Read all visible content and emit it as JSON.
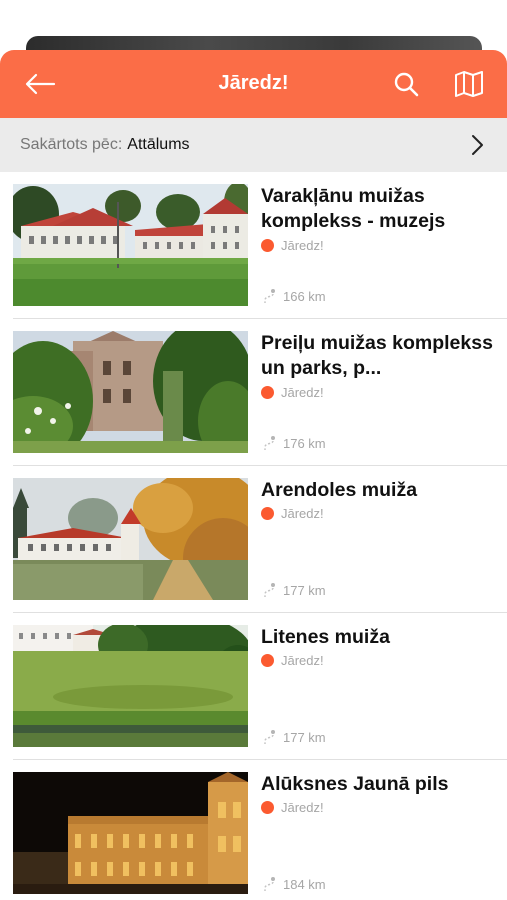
{
  "header": {
    "title": "Jāredz!",
    "back_icon": "arrow-left-icon",
    "search_icon": "search-icon",
    "map_icon": "map-icon",
    "color": "#fb6d47"
  },
  "sort": {
    "label": "Sakārtots pēc:",
    "value": "Attālums",
    "chevron_icon": "chevron-right-icon"
  },
  "places": [
    {
      "name": "Varakļānu muižas komplekss - muzejs",
      "category": "Jāredz!",
      "distance": "166 km"
    },
    {
      "name": "Preiļu muižas komplekss un parks, p...",
      "category": "Jāredz!",
      "distance": "176 km"
    },
    {
      "name": "Arendoles muiža",
      "category": "Jāredz!",
      "distance": "177 km"
    },
    {
      "name": "Litenes muiža",
      "category": "Jāredz!",
      "distance": "177 km"
    },
    {
      "name": "Alūksnes Jaunā pils",
      "category": "Jāredz!",
      "distance": "184 km"
    }
  ],
  "colors": {
    "accent": "#fb6d47",
    "category_dot": "#fb5a30",
    "muted_text": "#a6a6a6"
  }
}
